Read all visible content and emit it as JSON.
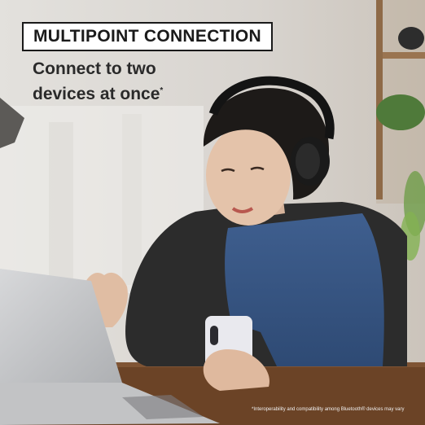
{
  "headline": "MULTIPOINT CONNECTION",
  "subhead_line1": "Connect to two",
  "subhead_line2": "devices at once",
  "subhead_mark": "*",
  "footnote": "*Interoperability and compatibility among Bluetooth® devices may vary",
  "colors": {
    "headline_border": "#1a1a1a",
    "headline_text": "#1a1a1a",
    "subhead_text": "#2a2a2a",
    "background_wall": "#d9d6d1"
  },
  "icons": {
    "headphones": "over-ear-headphones",
    "phone": "smartphone",
    "laptop": "laptop"
  }
}
